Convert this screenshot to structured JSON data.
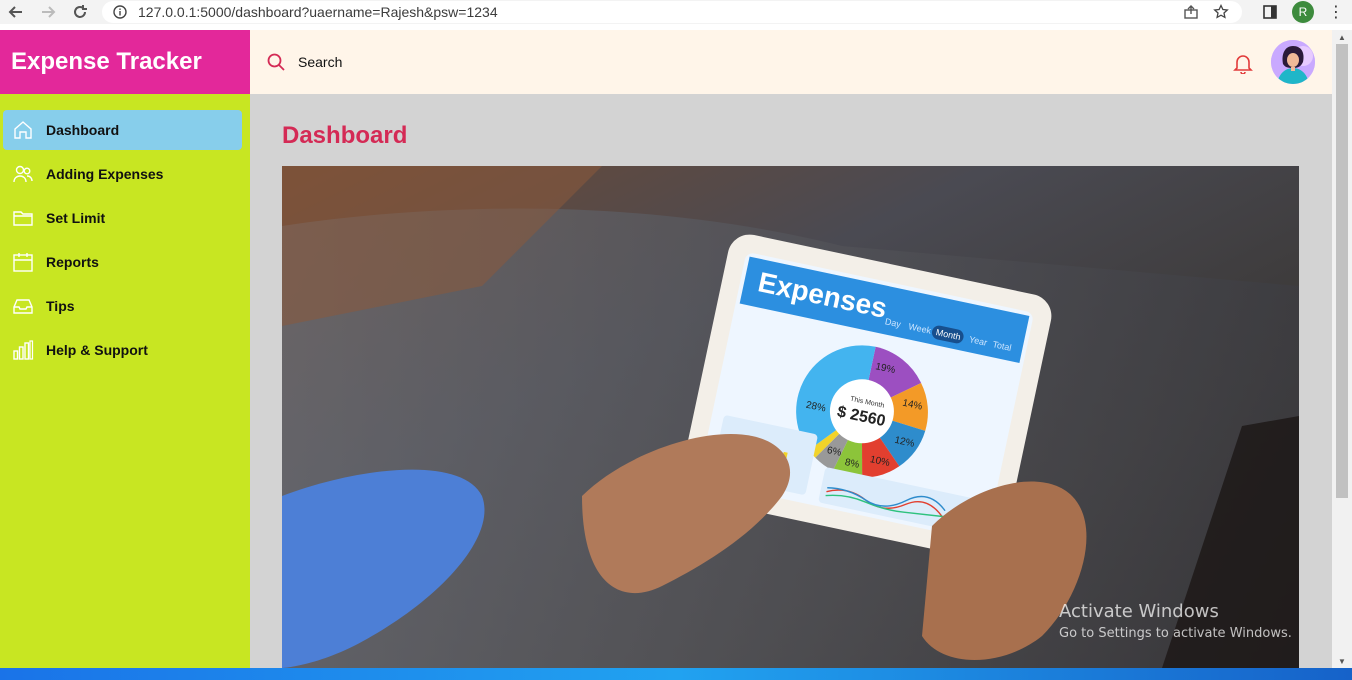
{
  "browser": {
    "url": "127.0.0.1:5000/dashboard?uaername=Rajesh&psw=1234",
    "profile_initial": "R"
  },
  "app": {
    "brand": "Expense Tracker",
    "menu": [
      {
        "label": "Dashboard",
        "icon": "home-icon",
        "active": true
      },
      {
        "label": "Adding Expenses",
        "icon": "users-icon"
      },
      {
        "label": "Set Limit",
        "icon": "folder-icon"
      },
      {
        "label": "Reports",
        "icon": "calendar-icon"
      },
      {
        "label": "Tips",
        "icon": "inbox-icon"
      },
      {
        "label": "Help & Support",
        "icon": "bar-chart-icon"
      }
    ],
    "search_label": "Search",
    "page_title": "Dashboard",
    "hero_image": {
      "tablet_heading": "Expenses",
      "tabs": [
        "Day",
        "Week",
        "Month",
        "Year",
        "Total"
      ],
      "center_label": "This Month",
      "center_value": "$ 2560",
      "slices": [
        "19%",
        "14%",
        "12%",
        "10%",
        "8%",
        "6%",
        "28%"
      ]
    }
  },
  "watermark": {
    "title": "Activate Windows",
    "subtitle": "Go to Settings to activate Windows."
  },
  "colors": {
    "sidebar": "#c8e622",
    "brand_bg": "#e3289a",
    "active_item": "#87ceeb",
    "topbar": "#fff5e9",
    "title": "#d42a55",
    "content_bg": "#d3d3d3"
  }
}
